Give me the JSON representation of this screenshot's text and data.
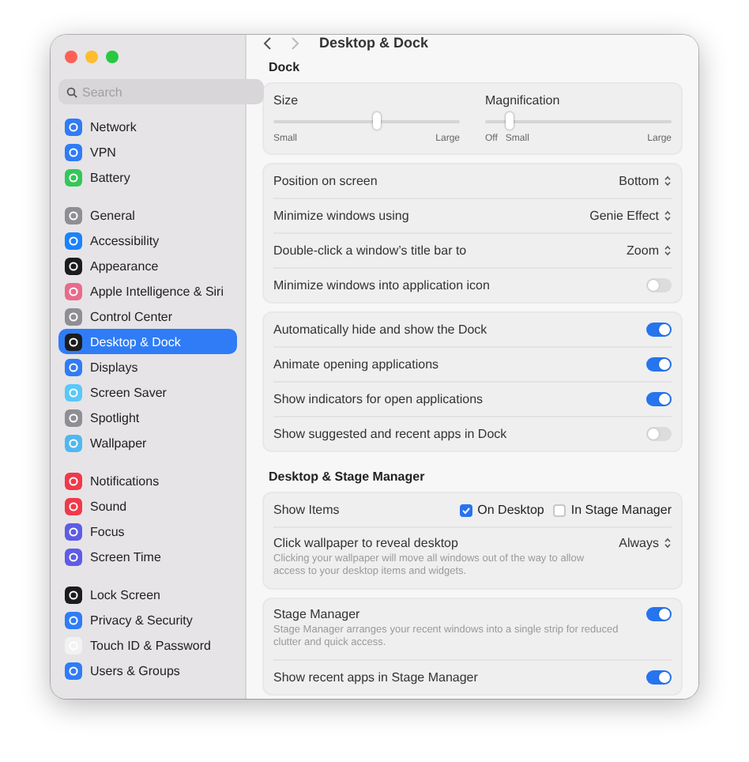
{
  "window": {
    "title": "Desktop & Dock"
  },
  "sidebar": {
    "search": {
      "placeholder": "Search"
    },
    "groups": [
      {
        "items": [
          {
            "label": "Network",
            "color": "#2f7cf6",
            "selected": false
          },
          {
            "label": "VPN",
            "color": "#2f7cf6",
            "selected": false
          },
          {
            "label": "Battery",
            "color": "#34c759",
            "selected": false
          }
        ]
      },
      {
        "items": [
          {
            "label": "General",
            "color": "#8e8e93",
            "selected": false
          },
          {
            "label": "Accessibility",
            "color": "#1a82fb",
            "selected": false
          },
          {
            "label": "Appearance",
            "color": "#1c1c1e",
            "selected": false
          },
          {
            "label": "Apple Intelligence & Siri",
            "color": "#e96b8c",
            "selected": false
          },
          {
            "label": "Control Center",
            "color": "#8e8e93",
            "selected": false
          },
          {
            "label": "Desktop & Dock",
            "color": "#1c1c1e",
            "selected": true
          },
          {
            "label": "Displays",
            "color": "#2f7cf6",
            "selected": false
          },
          {
            "label": "Screen Saver",
            "color": "#5ac8fa",
            "selected": false
          },
          {
            "label": "Spotlight",
            "color": "#8e8e93",
            "selected": false
          },
          {
            "label": "Wallpaper",
            "color": "#4fb8f0",
            "selected": false
          }
        ]
      },
      {
        "items": [
          {
            "label": "Notifications",
            "color": "#f0394a",
            "selected": false
          },
          {
            "label": "Sound",
            "color": "#f0394a",
            "selected": false
          },
          {
            "label": "Focus",
            "color": "#5e5ce6",
            "selected": false
          },
          {
            "label": "Screen Time",
            "color": "#5e5ce6",
            "selected": false
          }
        ]
      },
      {
        "items": [
          {
            "label": "Lock Screen",
            "color": "#1c1c1e",
            "selected": false
          },
          {
            "label": "Privacy & Security",
            "color": "#2f7cf6",
            "selected": false
          },
          {
            "label": "Touch ID & Password",
            "color": "#f2f2f2",
            "selected": false
          },
          {
            "label": "Users & Groups",
            "color": "#2f7cf6",
            "selected": false
          }
        ]
      }
    ]
  },
  "sections": [
    {
      "title": "Dock",
      "groups": [
        {
          "kind": "sliders",
          "sliders": [
            {
              "label": "Size",
              "level": 0.55,
              "marks": [
                "Small",
                "Large"
              ]
            },
            {
              "label": "Magnification",
              "level": 0.13,
              "marks": [
                "Off",
                "Small",
                "Large"
              ]
            }
          ]
        },
        {
          "kind": "rows",
          "rows": [
            {
              "kind": "select",
              "label": "Position on screen",
              "value": "Bottom"
            },
            {
              "kind": "select",
              "label": "Minimize windows using",
              "value": "Genie Effect"
            },
            {
              "kind": "select",
              "label": "Double-click a window’s title bar to",
              "value": "Zoom"
            },
            {
              "kind": "toggle",
              "label": "Minimize windows into application icon",
              "on": false
            }
          ]
        },
        {
          "kind": "rows",
          "rows": [
            {
              "kind": "toggle",
              "label": "Automatically hide and show the Dock",
              "on": true
            },
            {
              "kind": "toggle",
              "label": "Animate opening applications",
              "on": true
            },
            {
              "kind": "toggle",
              "label": "Show indicators for open applications",
              "on": true
            },
            {
              "kind": "toggle",
              "label": "Show suggested and recent apps in Dock",
              "on": false
            }
          ]
        }
      ]
    },
    {
      "title": "Desktop & Stage Manager",
      "groups": [
        {
          "kind": "rows",
          "rows": [
            {
              "kind": "checkboxes",
              "label": "Show Items",
              "options": [
                {
                  "label": "On Desktop",
                  "checked": true
                },
                {
                  "label": "In Stage Manager",
                  "checked": false
                }
              ]
            },
            {
              "kind": "select",
              "label": "Click wallpaper to reveal desktop",
              "value": "Always",
              "description": "Clicking your wallpaper will move all windows out of the way to allow access to your desktop items and widgets."
            }
          ]
        },
        {
          "kind": "rows",
          "rows": [
            {
              "kind": "toggle",
              "label": "Stage Manager",
              "on": true,
              "description": "Stage Manager arranges your recent windows into a single strip for reduced clutter and quick access."
            },
            {
              "kind": "toggle",
              "label": "Show recent apps in Stage Manager",
              "on": true
            }
          ]
        }
      ]
    }
  ]
}
